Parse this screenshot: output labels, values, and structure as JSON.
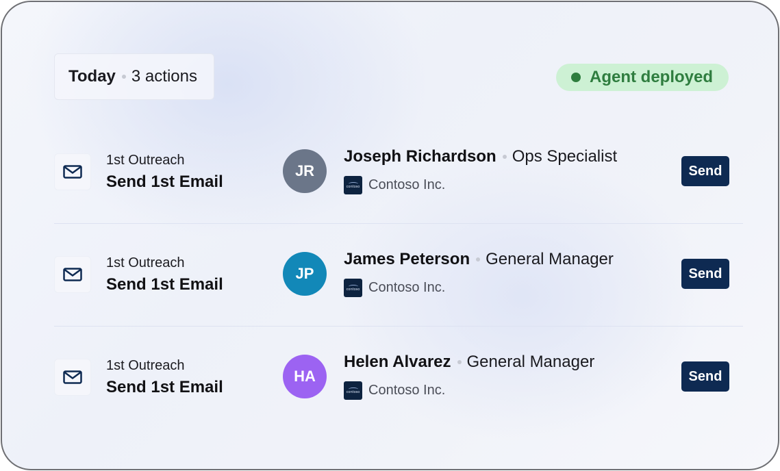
{
  "header": {
    "today_label": "Today",
    "actions_count": "3 actions",
    "status": {
      "label": "Agent deployed",
      "color": "#2e7d3e",
      "background": "#cdf1d4"
    }
  },
  "icons": {
    "step_icon": "mail-icon",
    "company_icon": "contoso-logo"
  },
  "rows": [
    {
      "step_label": "1st Outreach",
      "step_title": "Send 1st Email",
      "initials": "JR",
      "avatar_color": "#6b7689",
      "name": "Joseph Richardson",
      "role": "Ops Specialist",
      "company": "Contoso Inc.",
      "logo_text": "contoso",
      "button": "Send"
    },
    {
      "step_label": "1st Outreach",
      "step_title": "Send 1st Email",
      "initials": "JP",
      "avatar_color": "#1288b8",
      "name": "James Peterson",
      "role": "General Manager",
      "company": "Contoso Inc.",
      "logo_text": "contoso",
      "button": "Send"
    },
    {
      "step_label": "1st Outreach",
      "step_title": "Send 1st Email",
      "initials": "HA",
      "avatar_color": "#9c63f2",
      "name": "Helen Alvarez",
      "role": "General Manager",
      "company": "Contoso Inc.",
      "logo_text": "contoso",
      "button": "Send"
    }
  ],
  "colors": {
    "button": "#0e2a52",
    "logo_background": "#0d2340"
  }
}
